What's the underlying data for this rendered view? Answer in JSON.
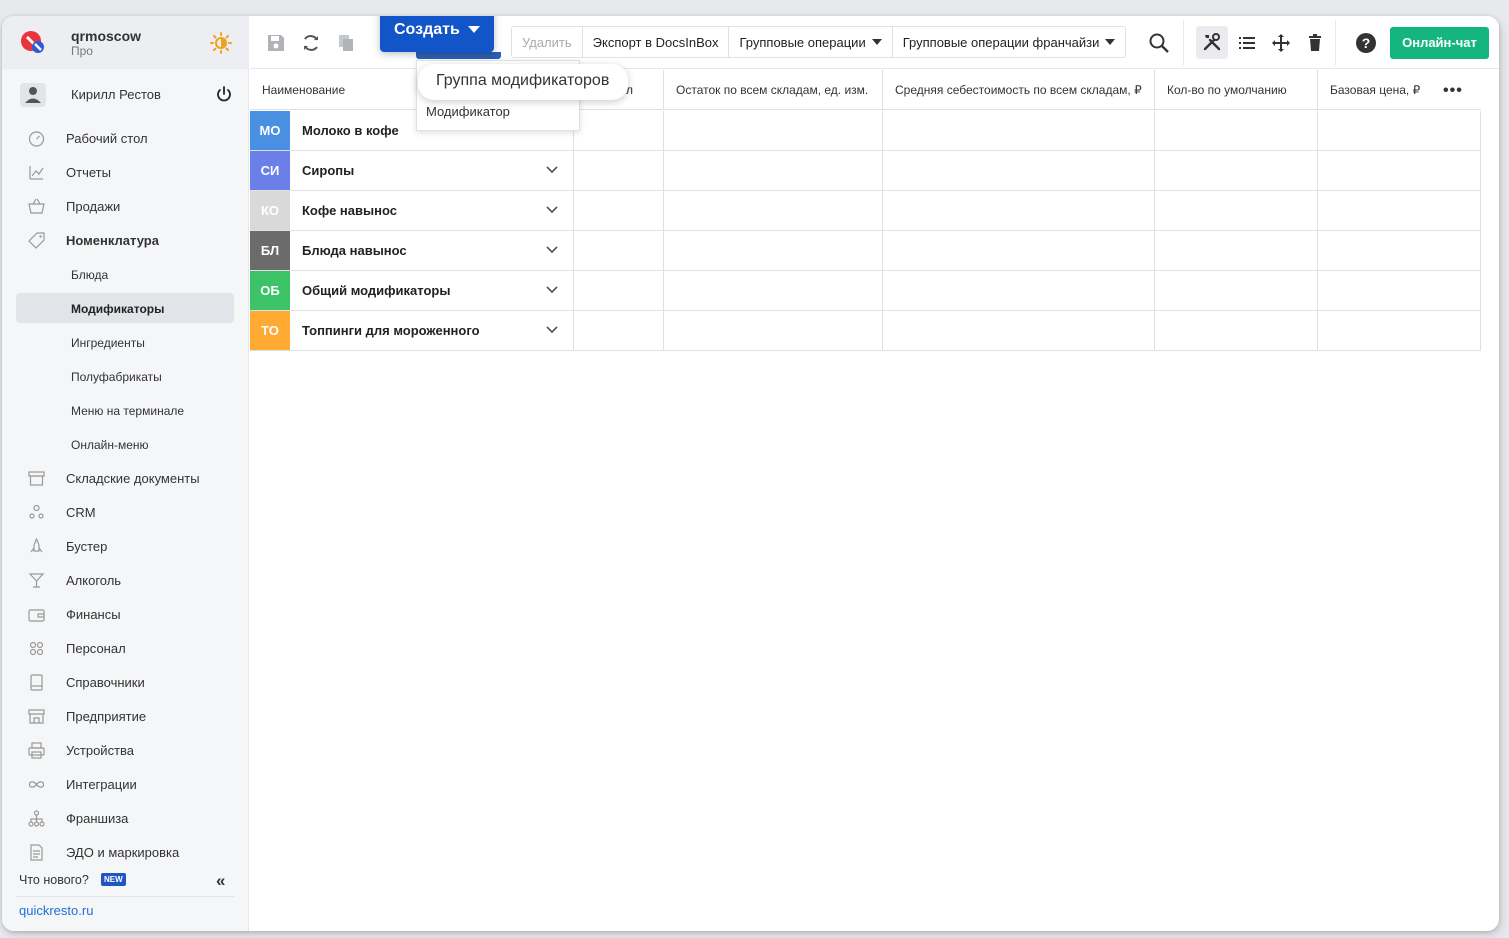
{
  "org": {
    "name": "qrmoscow",
    "plan": "Про"
  },
  "user": {
    "name": "Кирилл Рестов"
  },
  "nav": {
    "dashboard": "Рабочий стол",
    "reports": "Отчеты",
    "sales": "Продажи",
    "nomenclature": "Номенклатура",
    "dishes": "Блюда",
    "modifiers": "Модификаторы",
    "ingredients": "Ингредиенты",
    "semis": "Полуфабрикаты",
    "terminal_menu": "Меню на терминале",
    "online_menu": "Онлайн-меню",
    "warehouse": "Складские документы",
    "crm": "CRM",
    "booster": "Бустер",
    "alcohol": "Алкоголь",
    "finance": "Финансы",
    "staff": "Персонал",
    "refs": "Справочники",
    "company": "Предприятие",
    "devices": "Устройства",
    "integrations": "Интеграции",
    "franchise": "Франшиза",
    "edo": "ЭДО и маркировка"
  },
  "footer": {
    "whats_new": "Что нового?",
    "new_badge": "NEW",
    "collapse": "«",
    "site": "quickresto.ru"
  },
  "toolbar": {
    "create": "Создать",
    "delete": "Удалить",
    "export": "Экспорт в DocsInBox",
    "group_ops": "Групповые операции",
    "group_ops_franchise": "Групповые операции франчайзи",
    "online_chat": "Онлайн-чат",
    "help": "?"
  },
  "create_menu": {
    "item1": "Группа модификаторов",
    "item2": "Модификатор"
  },
  "columns": {
    "name": "Наименование",
    "hidden": "л",
    "stock": "Остаток по всем складам, ед. изм.",
    "avg_cost": "Средняя себестоимость по всем складам, ₽",
    "default_qty": "Кол-во по умолчанию",
    "base_price": "Базовая цена, ₽",
    "more": "•••"
  },
  "rows": [
    {
      "abbr": "МО",
      "name": "Молоко в кофе",
      "color": "#4a90e2"
    },
    {
      "abbr": "СИ",
      "name": "Сиропы",
      "color": "#6b7fe8"
    },
    {
      "abbr": "КО",
      "name": "Кофе навынос",
      "color": "#d9d9d9"
    },
    {
      "abbr": "БЛ",
      "name": "Блюда навынос",
      "color": "#6b6b6b"
    },
    {
      "abbr": "ОБ",
      "name": "Общий модификаторы",
      "color": "#3cc368"
    },
    {
      "abbr": "ТО",
      "name": "Топпинги для мороженного",
      "color": "#ffab33"
    }
  ],
  "colors": {
    "accent": "#1255c8",
    "chat": "#15b57f",
    "link": "#1f6fd6"
  }
}
